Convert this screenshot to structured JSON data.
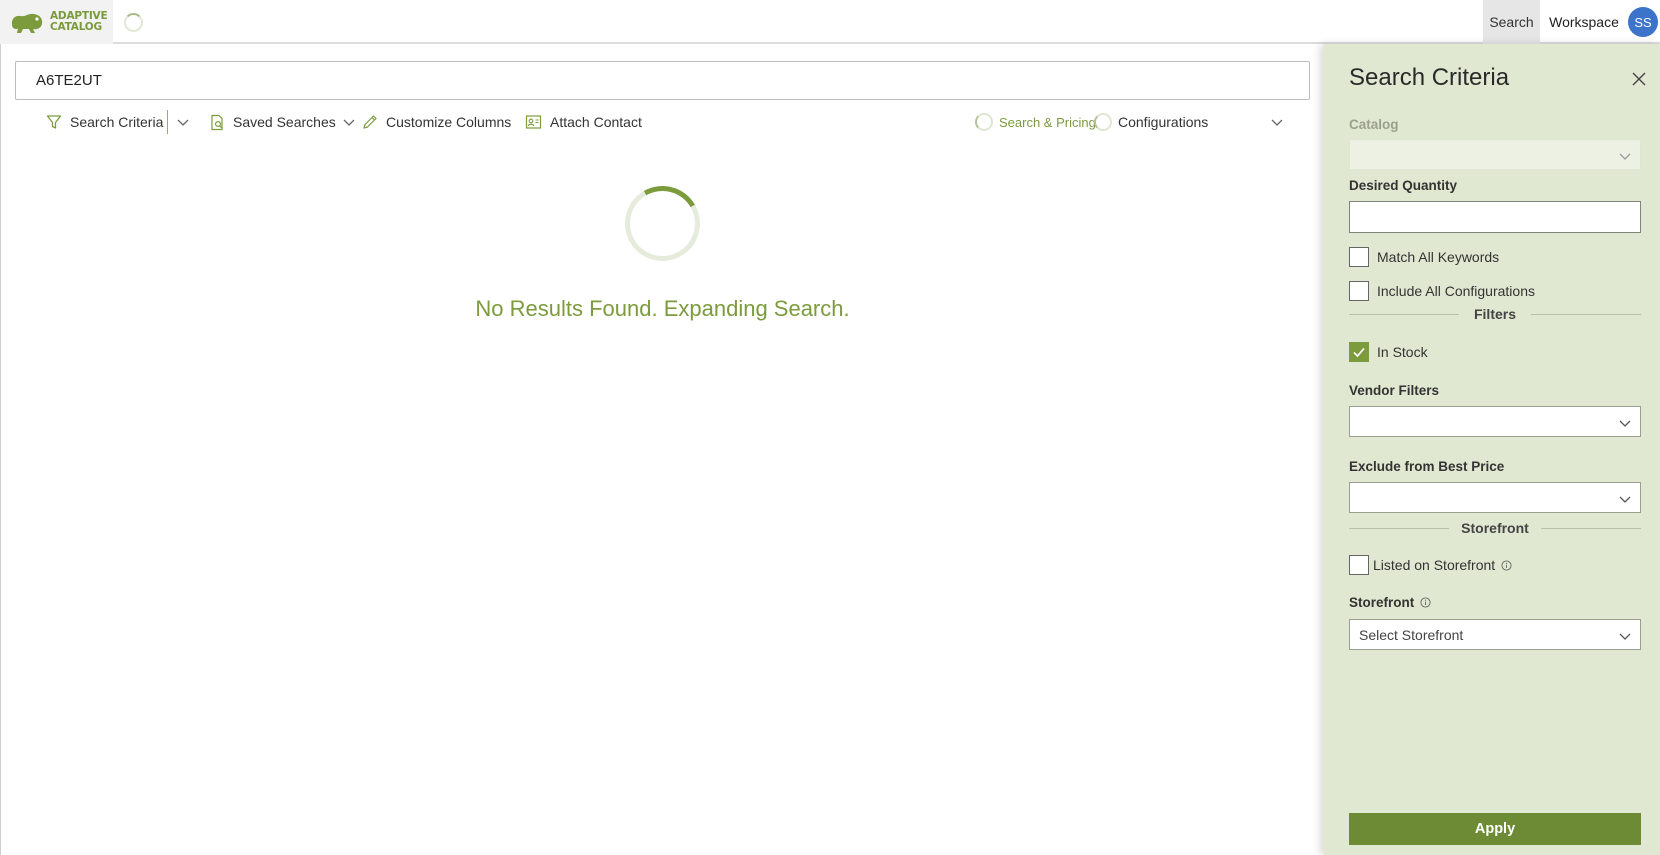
{
  "app": {
    "logo_line1": "ADAPTIVE",
    "logo_line2": "CATALOG",
    "brand_color": "#7b9b3d"
  },
  "nav": {
    "search_label": "Search",
    "workspace_label": "Workspace",
    "avatar_initials": "SS"
  },
  "search": {
    "value": "A6TE2UT"
  },
  "toolbar": {
    "search_criteria_label": "Search Criteria",
    "saved_searches_label": "Saved Searches",
    "customize_columns_label": "Customize Columns",
    "attach_contact_label": "Attach Contact",
    "search_pricing_label": "Search & Pricing",
    "configurations_label": "Configurations"
  },
  "results": {
    "status_message": "No Results Found. Expanding Search."
  },
  "panel": {
    "title": "Search Criteria",
    "catalog_label": "Catalog",
    "catalog_value": "",
    "desired_quantity_label": "Desired Quantity",
    "desired_quantity_value": "",
    "match_all_keywords_label": "Match All Keywords",
    "match_all_keywords_checked": false,
    "include_all_configurations_label": "Include All Configurations",
    "include_all_configurations_checked": false,
    "filters_section": "Filters",
    "in_stock_label": "In Stock",
    "in_stock_checked": true,
    "vendor_filters_label": "Vendor Filters",
    "vendor_filters_value": "",
    "exclude_best_price_label": "Exclude from Best Price",
    "exclude_best_price_value": "",
    "storefront_section": "Storefront",
    "listed_on_storefront_label": "Listed on Storefront",
    "listed_on_storefront_checked": false,
    "storefront_label": "Storefront",
    "storefront_placeholder": "Select Storefront",
    "apply_label": "Apply"
  }
}
